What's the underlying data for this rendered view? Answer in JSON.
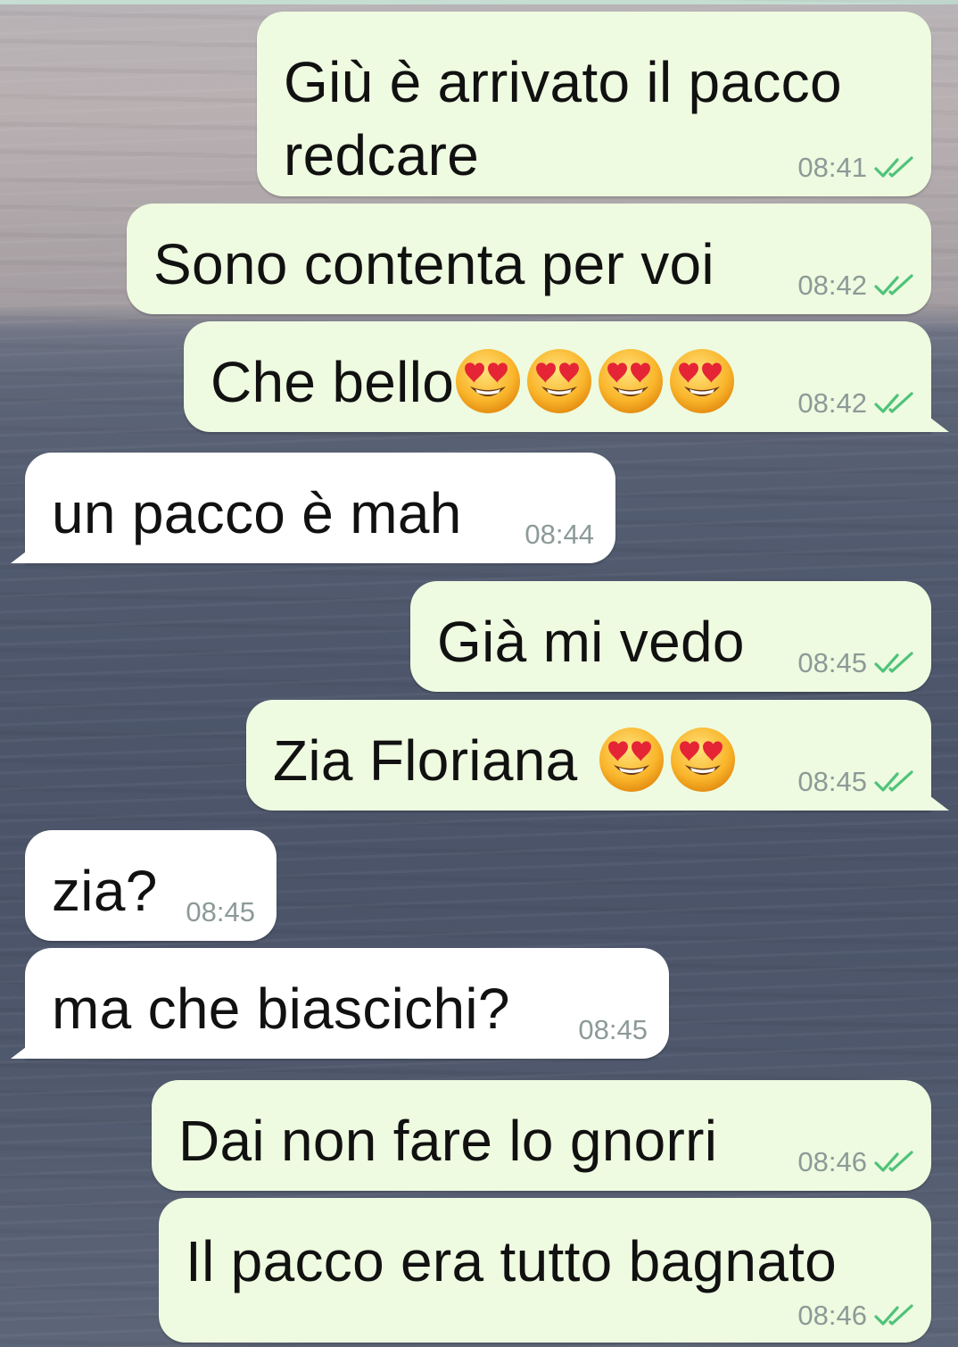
{
  "messages": [
    {
      "id": "m1",
      "dir": "out",
      "lines": [
        "Giù è arrivato il pacco",
        "redcare"
      ],
      "time": "08:41",
      "status": "read"
    },
    {
      "id": "m2",
      "dir": "out",
      "text": "Sono contenta per voi",
      "time": "08:42",
      "status": "read"
    },
    {
      "id": "m3",
      "dir": "out",
      "text": "Che bello",
      "emoji": [
        "heart-eyes",
        "heart-eyes",
        "heart-eyes",
        "heart-eyes"
      ],
      "time": "08:42",
      "status": "read"
    },
    {
      "id": "m4",
      "dir": "in",
      "text": "un pacco è mah",
      "time": "08:44"
    },
    {
      "id": "m5",
      "dir": "out",
      "text": "Già mi vedo",
      "time": "08:45",
      "status": "read"
    },
    {
      "id": "m6",
      "dir": "out",
      "text": "Zia Floriana",
      "emoji": [
        "heart-eyes",
        "heart-eyes"
      ],
      "time": "08:45",
      "status": "read"
    },
    {
      "id": "m7",
      "dir": "in",
      "text": "zia?",
      "time": "08:45"
    },
    {
      "id": "m8",
      "dir": "in",
      "text": "ma che biascichi?",
      "time": "08:45"
    },
    {
      "id": "m9",
      "dir": "out",
      "text": "Dai non fare lo gnorri",
      "time": "08:46",
      "status": "read"
    },
    {
      "id": "m10",
      "dir": "out",
      "text": "Il pacco era tutto bagnato",
      "time": "08:46",
      "status": "read"
    }
  ],
  "colors": {
    "outgoing_bubble": "#eefbe0",
    "incoming_bubble": "#ffffff",
    "tick": "#4fc37a",
    "time": "#8c9a98"
  }
}
